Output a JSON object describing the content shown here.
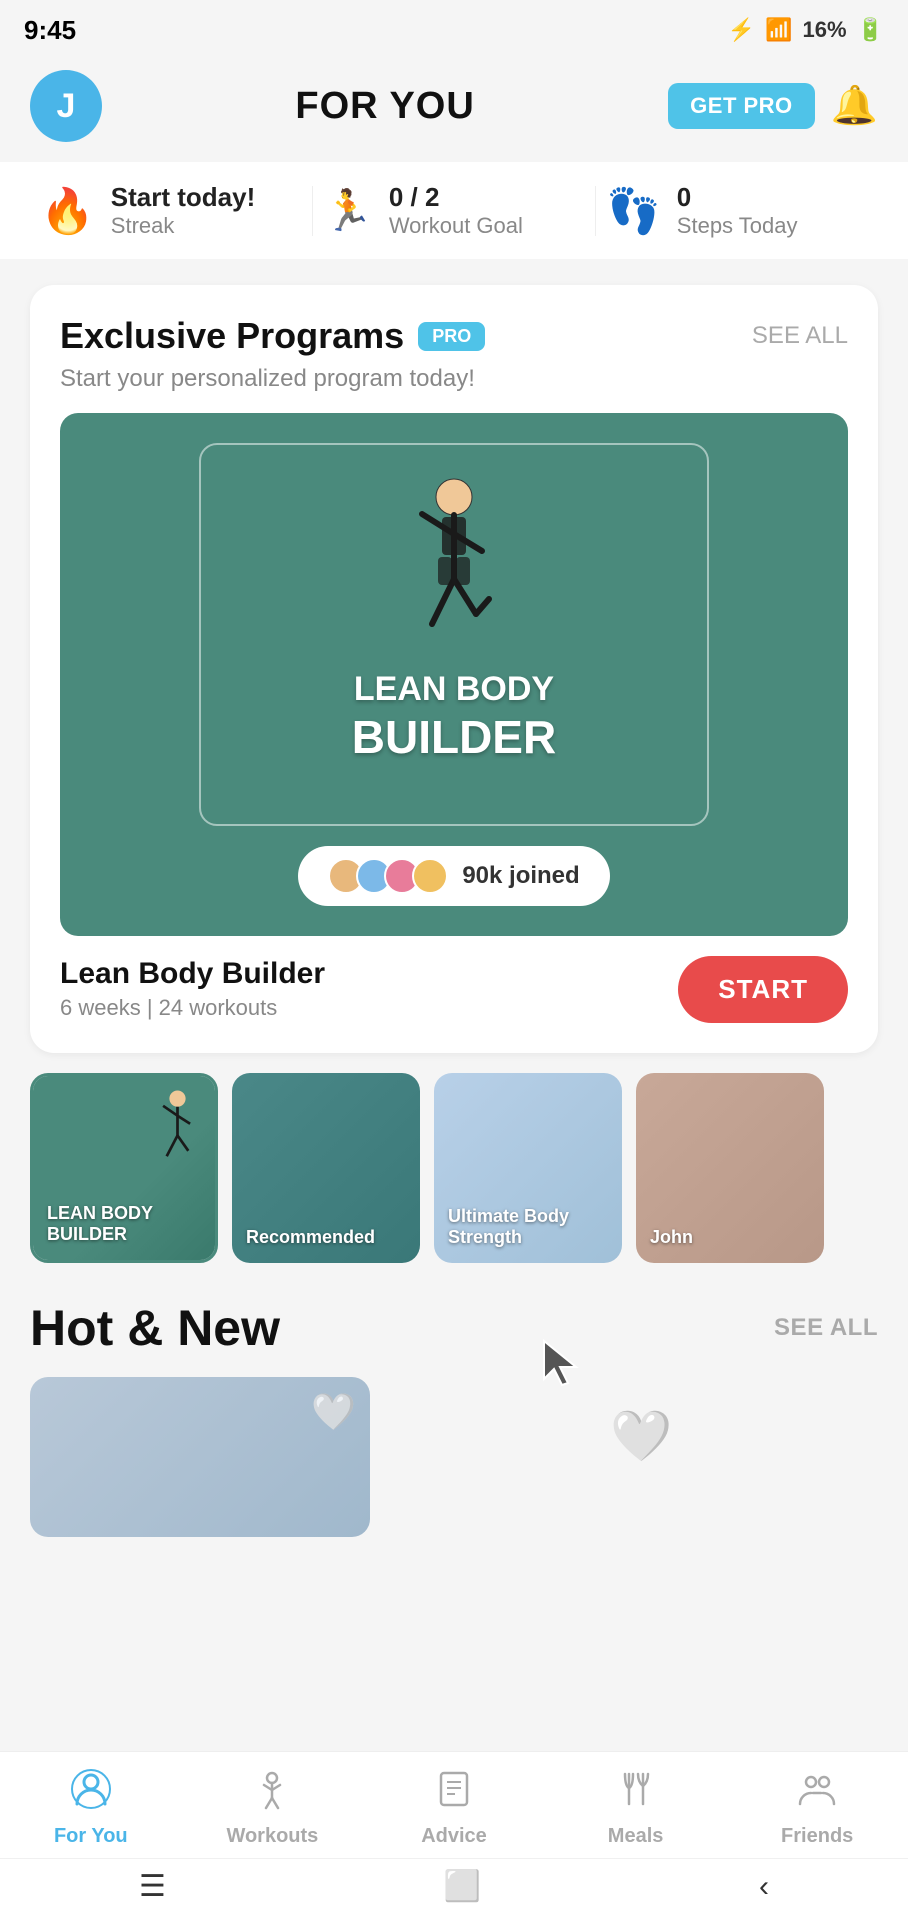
{
  "statusBar": {
    "time": "9:45",
    "batteryPercent": "16%"
  },
  "header": {
    "avatarLetter": "J",
    "title": "FOR YOU",
    "getProLabel": "GET PRO"
  },
  "stats": {
    "streak": {
      "icon": "🔥",
      "label": "Streak",
      "value": "Start today!"
    },
    "workoutGoal": {
      "icon": "🏃",
      "label": "Workout Goal",
      "value": "0 / 2"
    },
    "stepsToday": {
      "icon": "👣",
      "label": "Steps Today",
      "value": "0"
    }
  },
  "exclusivePrograms": {
    "title": "Exclusive Programs",
    "proBadge": "PRO",
    "seeAllLabel": "SEE ALL",
    "subtitle": "Start your personalized program today!",
    "program": {
      "name": "LEAN BODY",
      "nameBig": "BUILDER",
      "joined": "90k joined",
      "infoName": "Lean Body Builder",
      "infoDetail": "6 weeks | 24 workouts",
      "startLabel": "START"
    }
  },
  "carousel": {
    "items": [
      {
        "label": "LEAN BODY\nBUILDER",
        "type": "dark-teal"
      },
      {
        "label": "Recommended",
        "type": "teal"
      },
      {
        "label": "Ultimate Body\nStrength",
        "type": "light-blue"
      },
      {
        "label": "John",
        "type": "warm"
      }
    ]
  },
  "hotAndNew": {
    "title": "Hot & New",
    "seeAllLabel": "SEE ALL"
  },
  "bottomNav": {
    "items": [
      {
        "id": "for-you",
        "icon": "person-circle",
        "label": "For You",
        "active": true
      },
      {
        "id": "workouts",
        "icon": "person-run",
        "label": "Workouts",
        "active": false
      },
      {
        "id": "advice",
        "icon": "document",
        "label": "Advice",
        "active": false
      },
      {
        "id": "meals",
        "icon": "fork-knife",
        "label": "Meals",
        "active": false
      },
      {
        "id": "friends",
        "icon": "people",
        "label": "Friends",
        "active": false
      }
    ]
  }
}
